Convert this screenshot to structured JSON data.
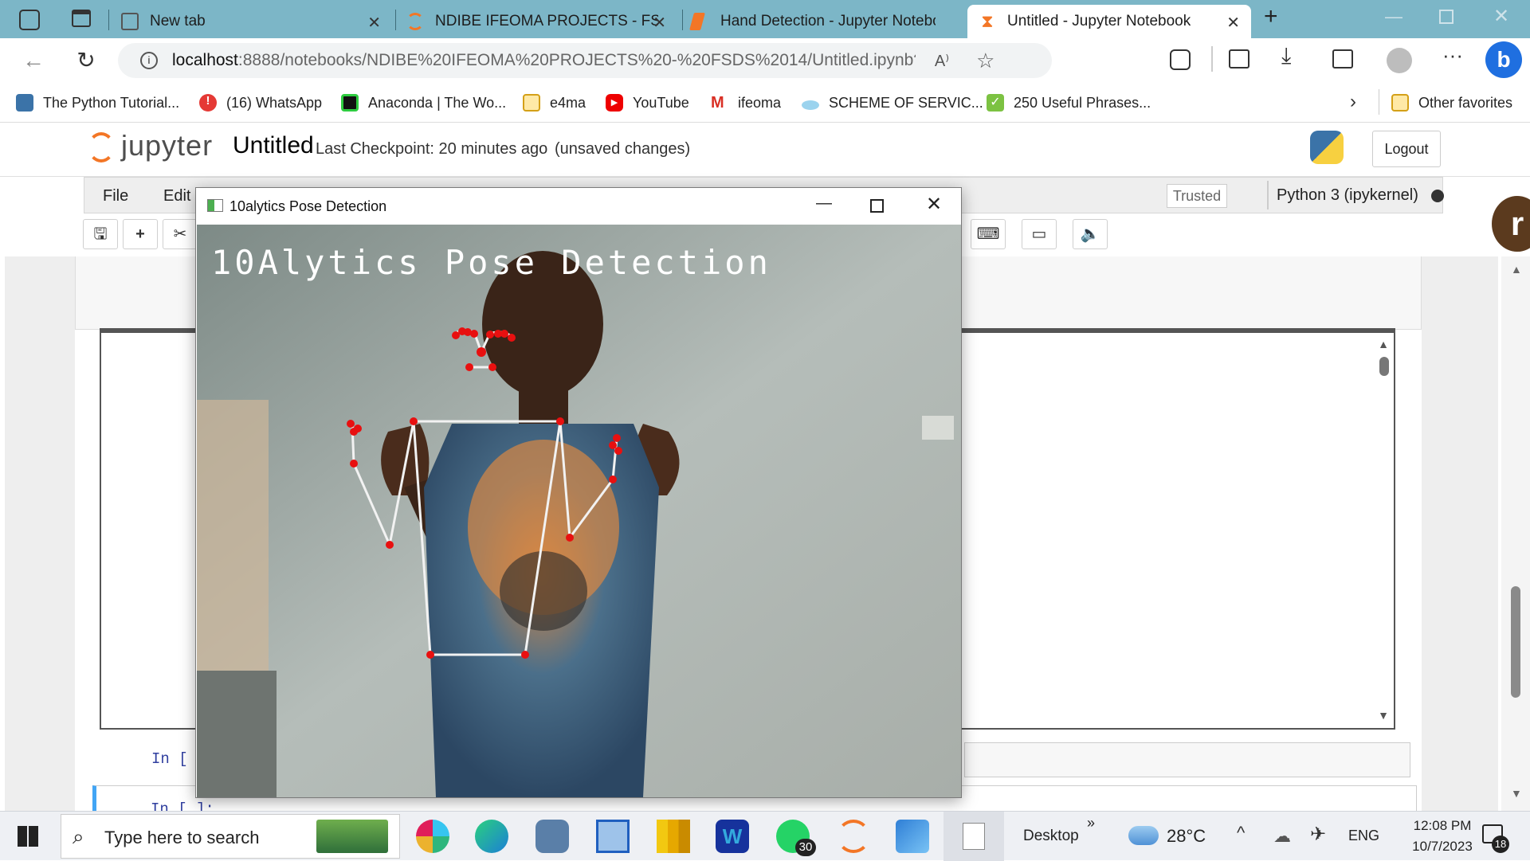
{
  "browser": {
    "tabs": [
      {
        "title": "New tab"
      },
      {
        "title": "NDIBE IFEOMA PROJECTS - FSDS"
      },
      {
        "title": "Hand Detection - Jupyter Notebo"
      },
      {
        "title": "Untitled - Jupyter Notebook"
      }
    ],
    "url_host": "localhost",
    "url_path": ":8888/notebooks/NDIBE%20IFEOMA%20PROJECTS%20-%20FSDS%2014/Untitled.ipynb?kernel_name=pyt...",
    "bookmarks": [
      {
        "label": "The Python Tutorial..."
      },
      {
        "label": "(16) WhatsApp"
      },
      {
        "label": "Anaconda | The Wo..."
      },
      {
        "label": "e4ma"
      },
      {
        "label": "YouTube"
      },
      {
        "label": "ifeoma"
      },
      {
        "label": "SCHEME OF SERVIC..."
      },
      {
        "label": "250 Useful Phrases..."
      }
    ],
    "other_favorites": "Other favorites"
  },
  "jupyter": {
    "logo_text": "jupyter",
    "notebook_name": "Untitled",
    "checkpoint": "Last Checkpoint: 20 minutes ago",
    "unsaved": "(unsaved changes)",
    "logout": "Logout",
    "menu": {
      "file": "File",
      "edit": "Edit"
    },
    "trusted": "Trusted",
    "kernel": "Python 3 (ipykernel)",
    "prompt1": "In [",
    "prompt2": "In [ ]:"
  },
  "pose_window": {
    "title": "10alytics Pose Detection",
    "overlay_text": "10Alytics Pose Detection"
  },
  "taskbar": {
    "search_placeholder": "Type here to search",
    "desktop_label": "Desktop",
    "weather": "28°C",
    "lang": "ENG",
    "time": "12:08 PM",
    "date": "10/7/2023",
    "whatsapp_badge": "30",
    "notif_badge": "18"
  }
}
